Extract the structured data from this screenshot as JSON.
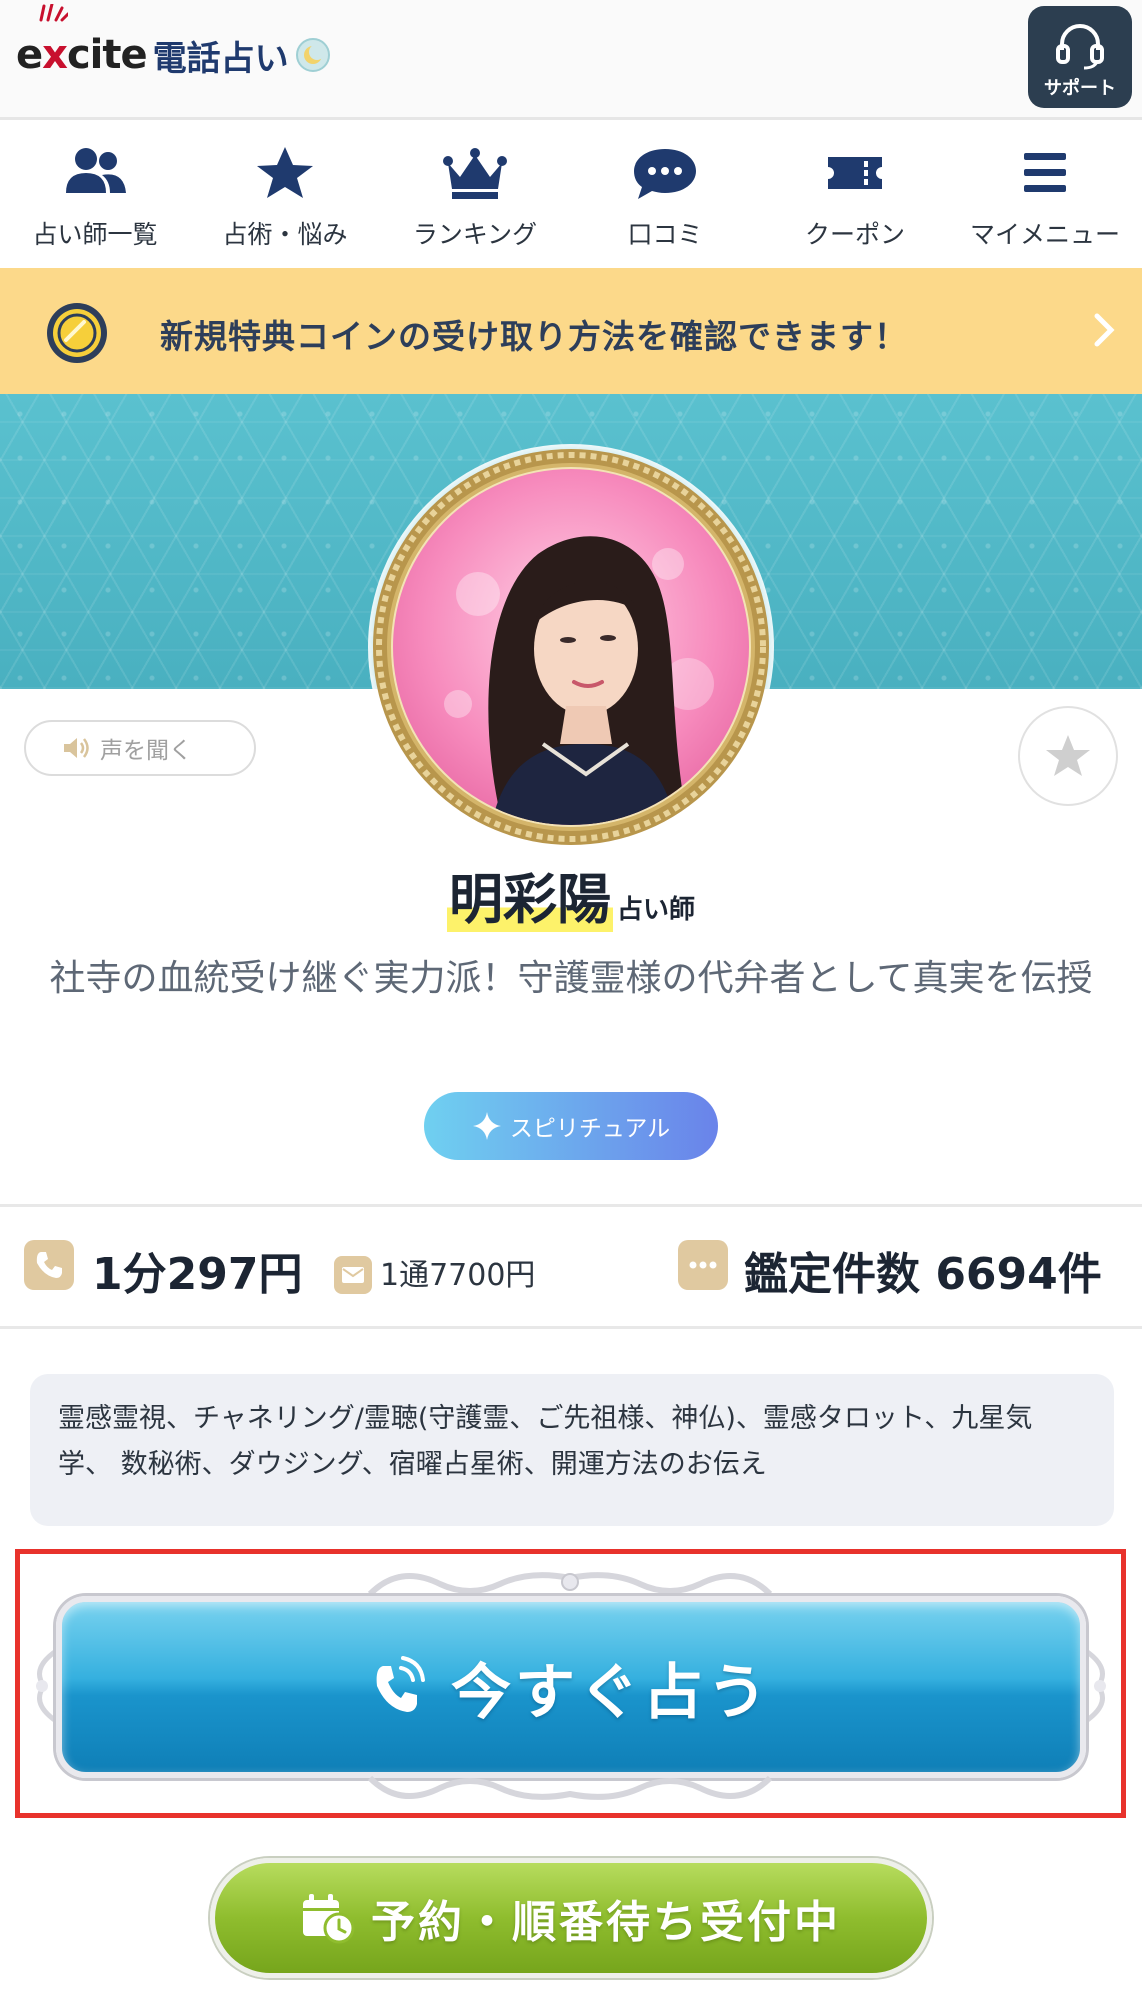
{
  "header": {
    "logo_text": "excite",
    "service_name": "電話占い",
    "support_label": "サポート"
  },
  "nav": {
    "items": [
      {
        "label": "占い師一覧",
        "icon": "users-icon"
      },
      {
        "label": "占術・悩み",
        "icon": "star-icon"
      },
      {
        "label": "ランキング",
        "icon": "crown-icon"
      },
      {
        "label": "口コミ",
        "icon": "chat-bubble-icon"
      },
      {
        "label": "クーポン",
        "icon": "ticket-icon"
      },
      {
        "label": "マイメニュー",
        "icon": "menu-icon"
      }
    ]
  },
  "banner": {
    "text": "新規特典コインの受け取り方法を確認できます！",
    "icon": "coin-icon"
  },
  "profile": {
    "voice_label": "声を聞く",
    "name": "明彩陽",
    "name_suffix": "占い師",
    "catchphrase": "社寺の血統受け継ぐ実力派！守護霊様の代弁者として真実を伝授",
    "tag": "スピリチュアル"
  },
  "stats": {
    "price_call": "1分297円",
    "price_mail": "1通7700円",
    "count": "鑑定件数 6694件"
  },
  "specialties": "霊感霊視、チャネリング/霊聴(守護霊、ご先祖様、神仏)、霊感タロット、九星気学、 数秘術、ダウジング、宿曜占星術、開運方法のお伝え",
  "cta": {
    "label": "今すぐ占う",
    "reserve_label": "予約・順番待ち受付中"
  },
  "colors": {
    "navy": "#1f3a6e",
    "banner_bg": "#fcd98a",
    "hero_teal": "#55bccb",
    "cta_blue": "#1a94cc",
    "reserve_green": "#8fbd2e",
    "highlight": "#e8322c"
  }
}
